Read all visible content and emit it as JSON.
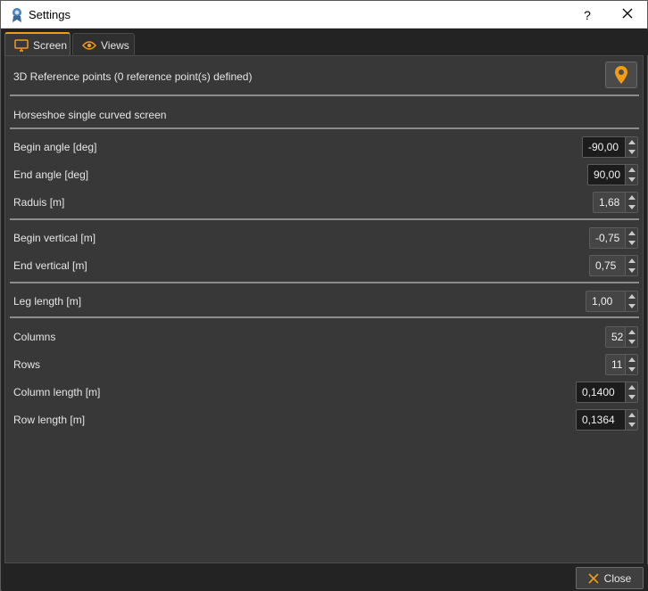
{
  "window": {
    "title": "Settings",
    "help_glyph": "?",
    "close_glyph": "✕"
  },
  "tabs": [
    {
      "label": "Screen",
      "icon": "monitor-icon",
      "active": true
    },
    {
      "label": "Views",
      "icon": "eye-icon",
      "active": false
    }
  ],
  "screen": {
    "reference_points_label": "3D Reference points (0 reference point(s) defined)",
    "reference_button_icon": "map-pin-icon",
    "screen_type_label": "Horseshoe single curved screen",
    "fields": {
      "begin_angle": {
        "label": "Begin angle [deg]",
        "value": "-90,00"
      },
      "end_angle": {
        "label": "End angle [deg]",
        "value": "90,00"
      },
      "radius": {
        "label": "Raduis [m]",
        "value": "1,68"
      },
      "begin_vertical": {
        "label": "Begin vertical [m]",
        "value": "-0,75"
      },
      "end_vertical": {
        "label": "End vertical [m]",
        "value": "0,75"
      },
      "leg_length": {
        "label": "Leg length [m]",
        "value": "1,00"
      },
      "columns": {
        "label": "Columns",
        "value": "52"
      },
      "rows": {
        "label": "Rows",
        "value": "11"
      },
      "column_length": {
        "label": "Column length [m]",
        "value": "0,1400"
      },
      "row_length": {
        "label": "Row length [m]",
        "value": "0,1364"
      }
    }
  },
  "footer": {
    "close_label": "Close",
    "close_icon": "close-x-icon"
  },
  "colors": {
    "accent": "#f39c12",
    "panel": "#383838",
    "background": "#232323"
  }
}
